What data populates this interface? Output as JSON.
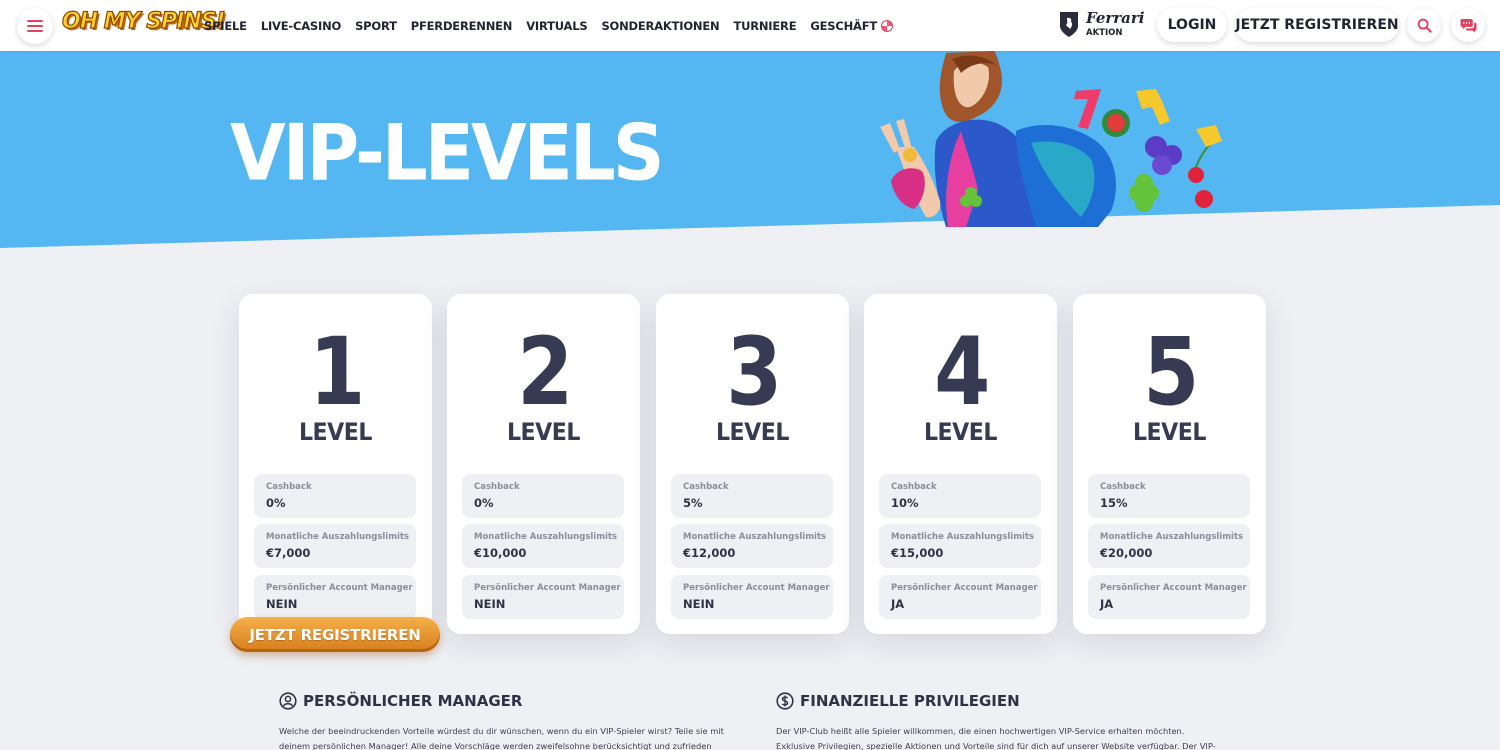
{
  "brand": {
    "logo_text": "OH MY SPINS!"
  },
  "header": {
    "nav": [
      "SPIELE",
      "LIVE-CASINO",
      "SPORT",
      "PFERDERENNEN",
      "VIRTUALS",
      "SONDERAKTIONEN",
      "TURNIERE",
      "GESCHÄFT"
    ],
    "promo": {
      "name": "Ferrari",
      "sub": "AKTION"
    },
    "login_label": "LOGIN",
    "register_label": "JETZT REGISTRIEREN"
  },
  "hero": {
    "title": "VIP-LEVELS"
  },
  "levels": [
    {
      "number": "1",
      "word": "LEVEL",
      "stats": [
        {
          "label": "Cashback",
          "value": "0%"
        },
        {
          "label": "Monatliche Auszahlungslimits",
          "value": "€7,000"
        },
        {
          "label": "Persönlicher Account Manager",
          "value": "NEIN"
        }
      ]
    },
    {
      "number": "2",
      "word": "LEVEL",
      "stats": [
        {
          "label": "Cashback",
          "value": "0%"
        },
        {
          "label": "Monatliche Auszahlungslimits",
          "value": "€10,000"
        },
        {
          "label": "Persönlicher Account Manager",
          "value": "NEIN"
        }
      ]
    },
    {
      "number": "3",
      "word": "LEVEL",
      "stats": [
        {
          "label": "Cashback",
          "value": "5%"
        },
        {
          "label": "Monatliche Auszahlungslimits",
          "value": "€12,000"
        },
        {
          "label": "Persönlicher Account Manager",
          "value": "NEIN"
        }
      ]
    },
    {
      "number": "4",
      "word": "LEVEL",
      "stats": [
        {
          "label": "Cashback",
          "value": "10%"
        },
        {
          "label": "Monatliche Auszahlungslimits",
          "value": "€15,000"
        },
        {
          "label": "Persönlicher Account Manager",
          "value": "JA"
        }
      ]
    },
    {
      "number": "5",
      "word": "LEVEL",
      "stats": [
        {
          "label": "Cashback",
          "value": "15%"
        },
        {
          "label": "Monatliche Auszahlungslimits",
          "value": "€20,000"
        },
        {
          "label": "Persönlicher Account Manager",
          "value": "JA"
        }
      ]
    }
  ],
  "cta": {
    "register_label": "JETZT REGISTRIEREN"
  },
  "sections": {
    "manager": {
      "title": "PERSÖNLICHER MANAGER",
      "text": "Welche der beeindruckenden Vorteile würdest du dir wünschen, wenn du ein VIP-Spieler wirst? Teile sie mit deinem persönlichen Manager! Alle deine Vorschläge werden zweifelsohne berücksichtigt und zufrieden gestellt. Wir freuen uns, dir zu helfen."
    },
    "finance": {
      "title": "FINANZIELLE PRIVILEGIEN",
      "text": "Der VIP-Club heißt alle Spieler willkommen, die einen hochwertigen VIP-Service erhalten möchten. Exklusive Privilegien, spezielle Aktionen und Vorteile sind für dich auf unserer Website verfügbar. Der VIP-Spieler-Status ermöglicht es dir, unglaublich hohe"
    }
  },
  "colors": {
    "hero_blue": "#54b7f2",
    "accent_pink": "#e2415f",
    "cta_orange": "#e8962f",
    "text_dark": "#363a53"
  }
}
